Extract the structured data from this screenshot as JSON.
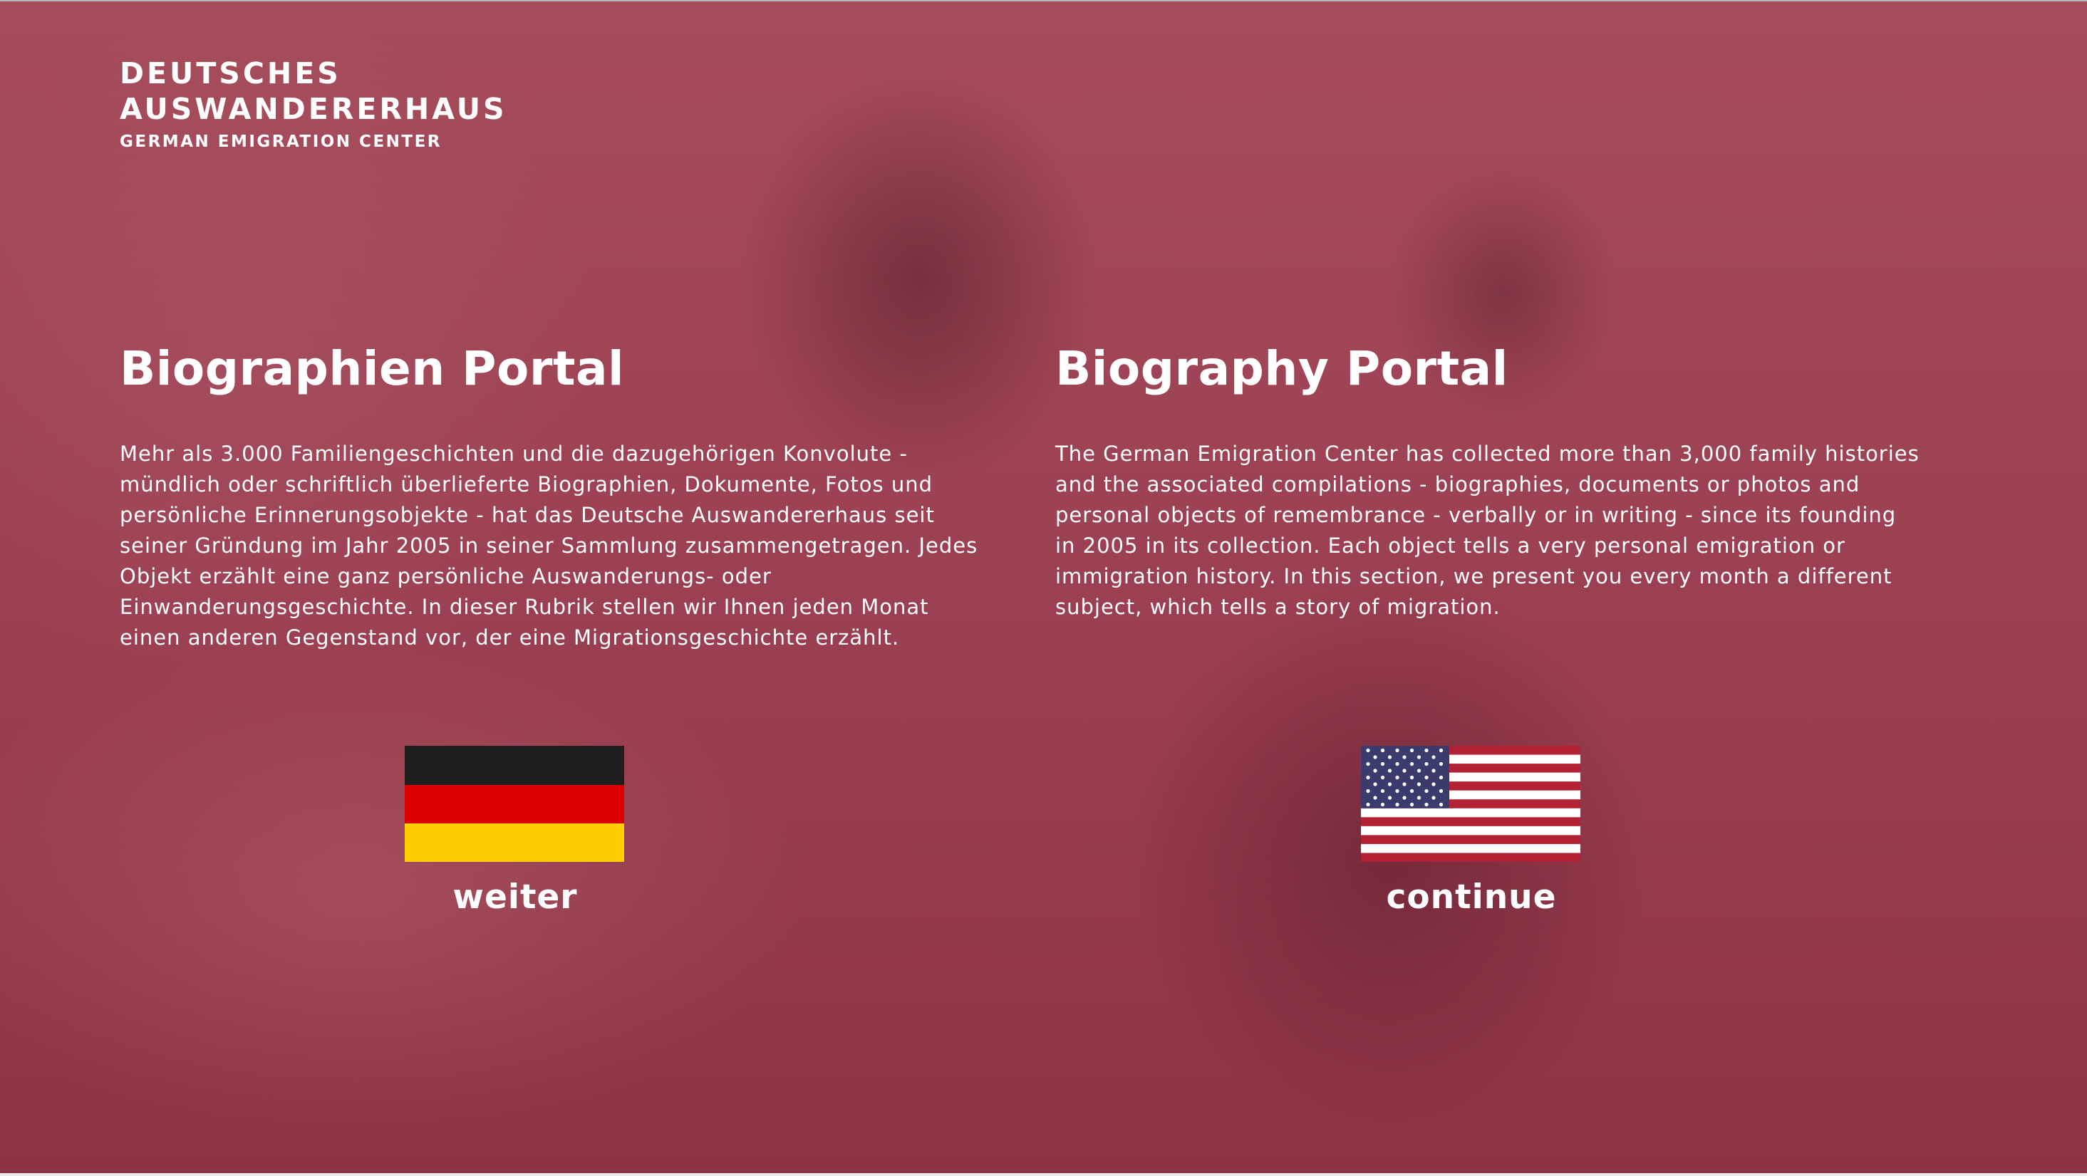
{
  "logo": {
    "line1": "DEUTSCHES",
    "line2": "AUSWANDERERHAUS",
    "subtitle": "GERMAN EMIGRATION CENTER"
  },
  "german": {
    "title": "Biographien Portal",
    "text": "Mehr als 3.000 Familiengeschichten und die dazugehörigen Konvolute -\nmündlich oder schriftlich überlieferte Biographien, Dokumente, Fotos und\npersönliche Erinnerungsobjekte - hat das Deutsche Auswandererhaus seit\nseiner Gründung im Jahr 2005 in seiner Sammlung zusammengetragen. Jedes\nObjekt erzählt eine ganz persönliche Auswanderungs- oder\nEinwanderungsgeschichte. In dieser Rubrik stellen wir Ihnen jeden Monat\neinen anderen Gegenstand vor, der eine Migrationsgeschichte erzählt.",
    "button_label": "weiter",
    "flag_icon": "german-flag-icon"
  },
  "english": {
    "title": "Biography Portal",
    "text": "The German Emigration Center has collected more than 3,000 family histories\nand the associated compilations - biographies, documents or photos and\npersonal objects of remembrance - verbally or in writing - since its founding\nin 2005 in its collection. Each object tells a very personal emigration or\nimmigration history. In this section, we present you every month a different\nsubject, which tells a story of migration.",
    "button_label": "continue",
    "flag_icon": "us-flag-icon"
  },
  "colors": {
    "overlay": "#9b4152",
    "text": "#ffffff",
    "flag_de": [
      "#1f1f1f",
      "#dd0000",
      "#ffce00"
    ],
    "flag_us_red": "#b22234",
    "flag_us_blue": "#3c3b6e"
  }
}
